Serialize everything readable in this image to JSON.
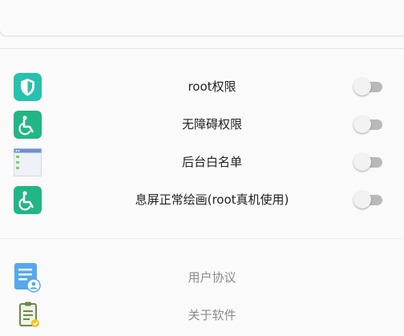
{
  "permissions": [
    {
      "label": "root权限",
      "icon": "shield-icon",
      "enabled": false
    },
    {
      "label": "无障碍权限",
      "icon": "accessibility-icon",
      "enabled": false
    },
    {
      "label": "后台白名单",
      "icon": "app-list-icon",
      "enabled": false
    },
    {
      "label": "息屏正常绘画(root真机使用)",
      "icon": "accessibility-icon",
      "enabled": false
    }
  ],
  "links": [
    {
      "label": "用户协议",
      "icon": "user-agreement-icon"
    },
    {
      "label": "关于软件",
      "icon": "about-clipboard-icon"
    }
  ],
  "colors": {
    "teal": "#2bbf9b",
    "toggle_off": "#b9b9b9"
  }
}
